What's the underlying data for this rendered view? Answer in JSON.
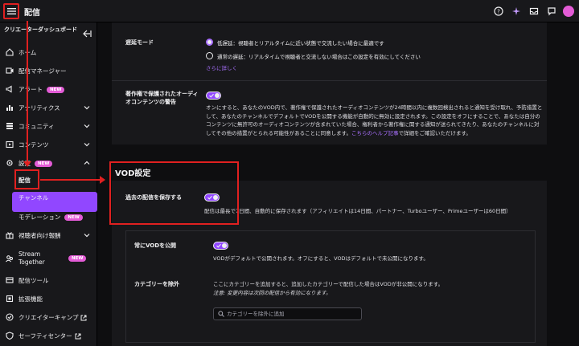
{
  "app": {
    "title": "配信"
  },
  "sidebar": {
    "header": "クリエーターダッシュボード",
    "items": [
      {
        "label": "ホーム",
        "icon": "home-icon"
      },
      {
        "label": "配信マネージャー",
        "icon": "stream-manager-icon"
      },
      {
        "label": "アラート",
        "icon": "alerts-icon",
        "badge": "NEW"
      },
      {
        "label": "アナリティクス",
        "icon": "analytics-icon"
      },
      {
        "label": "コミュニティ",
        "icon": "community-icon"
      },
      {
        "label": "コンテンツ",
        "icon": "content-icon"
      },
      {
        "label": "設定",
        "icon": "settings-icon",
        "badge": "NEW"
      },
      {
        "label": "配信"
      },
      {
        "label": "チャンネル"
      },
      {
        "label": "モデレーション",
        "badge": "NEW"
      },
      {
        "label": "視聴者向け報酬",
        "icon": "viewer-rewards-icon"
      },
      {
        "label": "Stream Together",
        "icon": "stream-together-icon",
        "badge": "NEW"
      },
      {
        "label": "配信ツール",
        "icon": "streaming-tools-icon"
      },
      {
        "label": "拡張機能",
        "icon": "extensions-icon"
      },
      {
        "label": "クリエイターキャンプ",
        "icon": "creator-camp-icon"
      },
      {
        "label": "セーフティセンター",
        "icon": "safety-center-icon"
      }
    ]
  },
  "latency": {
    "label": "遅延モード",
    "option_low": "低遅延：視聴者とリアルタイムに近い状態で交流したい場合に最適です",
    "option_normal": "通常の遅延：リアルタイムで視聴者と交流しない場合はこの設定を有効にしてください",
    "more": "さらに詳しく"
  },
  "copyright": {
    "label": "著作権で保護されたオーディオコンテンツの警告",
    "desc": "オンにすると、あなたのVOD内で、著作権で保護されたオーディオコンテンツが24時間以内に複数回検出されると通知を受け取れ、予防措置として、あなたのチャンネルでデフォルトでVODを公開する機能が自動的に無効に設定されます。この設定をオフにすることで、あなたは自分のコンテンツに無許可のオーディオコンテンツが含まれていた場合、権利者から著作権に関する通知が送られてきたり、あなたのチャンネルに対してその他の措置がとられる可能性があることに同意します。",
    "help_link": "こちらのヘルプ記事",
    "desc_tail": "で詳細をご確認いただけます。"
  },
  "vod": {
    "section_title": "VOD設定",
    "save_label": "過去の配信を保存する",
    "save_desc": "配信は最長で7日間、自動的に保存されます（アフィリエイトは14日間、パートナー、Turboユーザー、Primeユーザーは60日間）",
    "publish_label": "常にVODを公開",
    "publish_desc": "VODがデフォルトで公開されます。オフにすると、VODはデフォルトで未公開になります。",
    "exclude_label": "カテゴリーを除外",
    "exclude_desc": "ここにカテゴリーを追加すると、追加したカテゴリーで配信した場合はVODが非公開になります。",
    "exclude_note": "注意: 変更内容は次回の配信から有効になります。",
    "search_placeholder": "カテゴリーを除外に追加"
  },
  "colors": {
    "accent": "#9147ff",
    "annotation": "#e02020",
    "badge": "#e35bd6"
  }
}
